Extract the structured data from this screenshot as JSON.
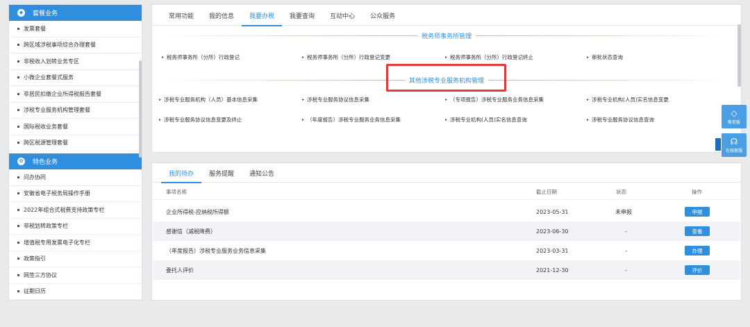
{
  "sidebar": {
    "sections": [
      {
        "title": "套餐业务",
        "icon": "layers-icon",
        "items": [
          "发票套餐",
          "跨区域涉税事项综合办理套餐",
          "非税收入划转业务专区",
          "小微企业套餐式服务",
          "非居民扣缴企业所得税报告套餐",
          "涉税专业服务机构管理套餐",
          "国际税收业务套餐",
          "跨区税源管理套餐"
        ]
      },
      {
        "title": "特色业务",
        "icon": "flower-icon",
        "items": [
          "问办协同",
          "安徽省电子税务局操作手册",
          "2022年组合式税费支持政策专栏",
          "非税划转政策专栏",
          "增值税专用发票电子化专栏",
          "政策指引",
          "网签三方协议",
          "征期日历"
        ]
      }
    ]
  },
  "top_tabs": [
    "常用功能",
    "我的信息",
    "我要办税",
    "我要查询",
    "互动中心",
    "公众服务"
  ],
  "top_active_tab": 2,
  "groups": [
    {
      "title": "税务师事务所管理",
      "rows": [
        [
          "税务师事务所（分所）行政登记",
          "税务师事务所（分所）行政登记变更",
          "税务师事务所（分所）行政登记终止",
          "审批状态查询"
        ]
      ]
    },
    {
      "title": "其他涉税专业服务机构管理",
      "rows": [
        [
          "涉税专业服务机构（人员）基本信息采集",
          "涉税专业服务协议信息采集",
          "（专项报告）涉税专业服务业务信息采集",
          "涉税专业机构(人员)实名信息变更"
        ],
        [
          "涉税专业服务协议信息变更及终止",
          "（年度报告）涉税专业服务业务信息采集",
          "涉税专业机构(人员)实名信息查询",
          "涉税专业服务协议信息查询"
        ]
      ]
    }
  ],
  "bottom_tabs": [
    "我的待办",
    "服务提醒",
    "通知公告"
  ],
  "bottom_active_tab": 0,
  "table": {
    "headers": [
      "事项名称",
      "截止日期",
      "状态",
      "操作"
    ],
    "rows": [
      {
        "name": "企业所得税-应纳税所得额",
        "date": "2023-05-31",
        "status": "未申报",
        "action": "申报"
      },
      {
        "name": "感谢信（减税降费）",
        "date": "2023-06-30",
        "status": "-",
        "action": "查看"
      },
      {
        "name": "（年度报告）涉税专业服务业务信息采集",
        "date": "2023-03-31",
        "status": "-",
        "action": "办理"
      },
      {
        "name": "委托人评价",
        "date": "2021-12-30",
        "status": "-",
        "action": "评价"
      }
    ]
  },
  "float_buttons": [
    {
      "label": "敬老版",
      "icon": "diamond-icon"
    },
    {
      "label": "在线客服",
      "icon": "headset-icon"
    }
  ],
  "colors": {
    "accent": "#2f8fde",
    "highlight": "#e4393c"
  }
}
